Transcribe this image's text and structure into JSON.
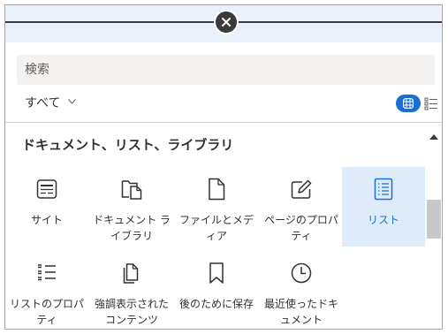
{
  "search": {
    "placeholder": "検索",
    "value": ""
  },
  "filter": {
    "label": "すべて"
  },
  "section": {
    "title": "ドキュメント、リスト、ライブラリ"
  },
  "colors": {
    "accent": "#1c6fd2",
    "selected_bg": "#deecf9"
  },
  "items": [
    {
      "label": "サイト",
      "icon": "site-icon",
      "selected": false
    },
    {
      "label": "ドキュメント ライブラリ",
      "icon": "document-library-icon",
      "selected": false
    },
    {
      "label": "ファイルとメディア",
      "icon": "file-icon",
      "selected": false
    },
    {
      "label": "ページのプロパティ",
      "icon": "edit-page-icon",
      "selected": false
    },
    {
      "label": "リスト",
      "icon": "list-icon",
      "selected": true
    },
    {
      "label": "リストのプロパティ",
      "icon": "list-properties-icon",
      "selected": false
    },
    {
      "label": "強調表示されたコンテンツ",
      "icon": "highlighted-content-icon",
      "selected": false
    },
    {
      "label": "後のために保存",
      "icon": "bookmark-icon",
      "selected": false
    },
    {
      "label": "最近使ったドキュメント",
      "icon": "clock-icon",
      "selected": false
    }
  ]
}
